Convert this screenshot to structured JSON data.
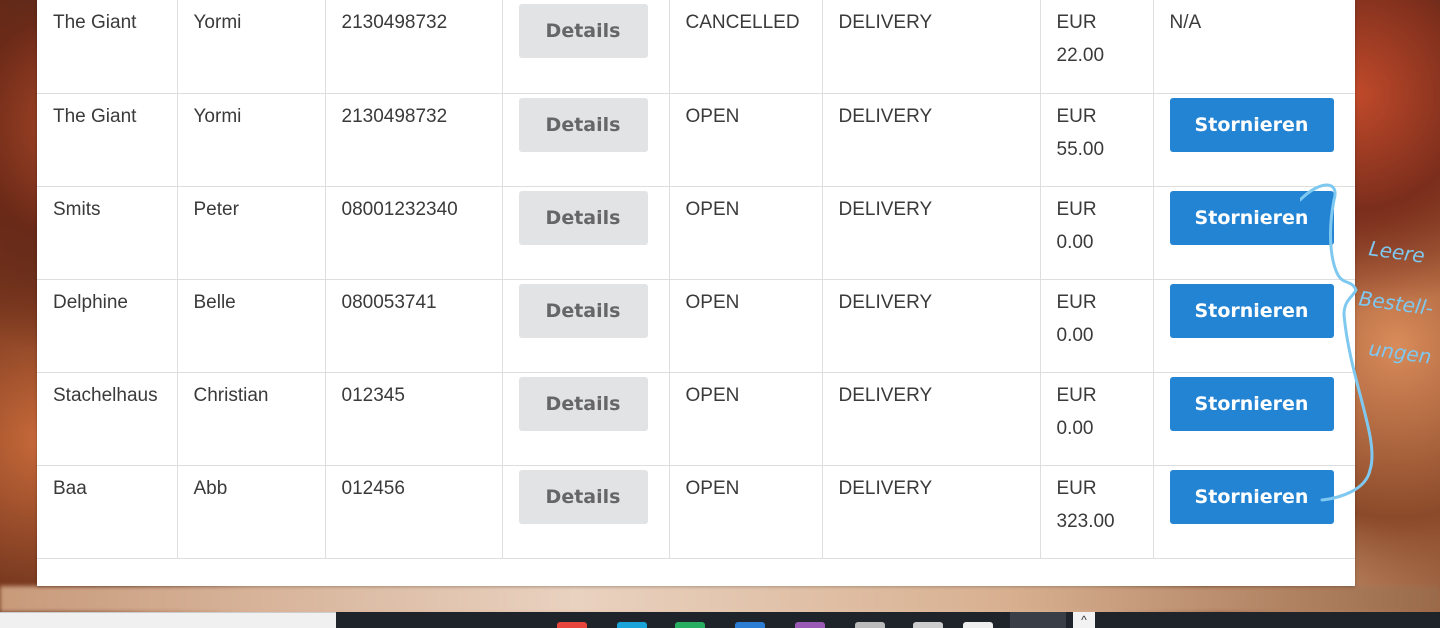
{
  "table": {
    "rows": [
      {
        "last_name": "The Giant",
        "first_name": "Yormi",
        "phone": "2130498732",
        "details_label": "Details",
        "status": "CANCELLED",
        "type": "DELIVERY",
        "currency": "EUR",
        "amount": "22.00",
        "action_text": "N/A",
        "action_button": null
      },
      {
        "last_name": "The Giant",
        "first_name": "Yormi",
        "phone": "2130498732",
        "details_label": "Details",
        "status": "OPEN",
        "type": "DELIVERY",
        "currency": "EUR",
        "amount": "55.00",
        "action_text": null,
        "action_button": "Stornieren"
      },
      {
        "last_name": "Smits",
        "first_name": "Peter",
        "phone": "08001232340",
        "details_label": "Details",
        "status": "OPEN",
        "type": "DELIVERY",
        "currency": "EUR",
        "amount": "0.00",
        "action_text": null,
        "action_button": "Stornieren"
      },
      {
        "last_name": "Delphine",
        "first_name": "Belle",
        "phone": "080053741",
        "details_label": "Details",
        "status": "OPEN",
        "type": "DELIVERY",
        "currency": "EUR",
        "amount": "0.00",
        "action_text": null,
        "action_button": "Stornieren"
      },
      {
        "last_name": "Stachelhaus",
        "first_name": "Christian",
        "phone": "012345",
        "details_label": "Details",
        "status": "OPEN",
        "type": "DELIVERY",
        "currency": "EUR",
        "amount": "0.00",
        "action_text": null,
        "action_button": "Stornieren"
      },
      {
        "last_name": "Baa",
        "first_name": "Abb",
        "phone": "012456",
        "details_label": "Details",
        "status": "OPEN",
        "type": "DELIVERY",
        "currency": "EUR",
        "amount": "323.00",
        "action_text": null,
        "action_button": "Stornieren"
      }
    ]
  },
  "annotation": {
    "handwritten_note": "Leere Bestellungen",
    "color": "#7fc8f0"
  },
  "colors": {
    "primary_button": "#2484d4",
    "secondary_button": "#e2e3e5"
  },
  "icons": {
    "taskbar_chevron": "chevron-up-icon"
  }
}
